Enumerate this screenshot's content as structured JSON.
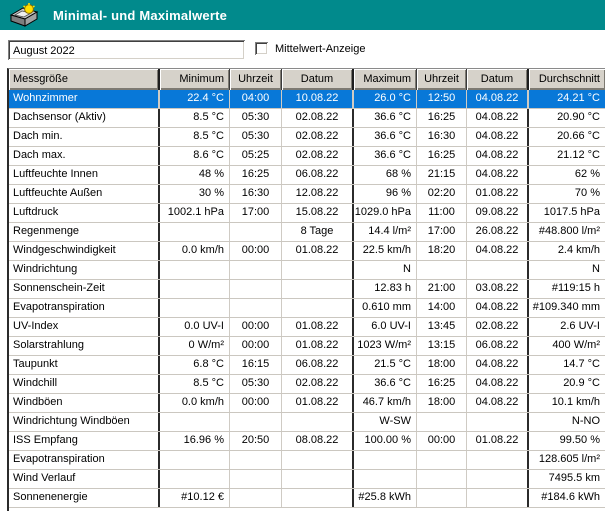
{
  "window": {
    "title": "Minimal- und Maximalwerte",
    "icon": "weather-station-icon"
  },
  "toolbar": {
    "period_value": "August 2022",
    "checkbox_label": "Mittelwert-Anzeige",
    "checkbox_checked": false
  },
  "colors": {
    "titlebar": "#018a8c",
    "selection": "#0878d8",
    "header_bg": "#d6d2ca"
  },
  "table": {
    "columns": [
      "Messgröße",
      "Minimum",
      "Uhrzeit",
      "Datum",
      "Maximum",
      "Uhrzeit",
      "Datum",
      "Durchschnitt"
    ],
    "selected_row": 0,
    "rows": [
      [
        "Wohnzimmer",
        "22.4 °C",
        "04:00",
        "10.08.22",
        "26.0 °C",
        "12:50",
        "04.08.22",
        "24.21 °C"
      ],
      [
        "Dachsensor (Aktiv)",
        "8.5 °C",
        "05:30",
        "02.08.22",
        "36.6 °C",
        "16:25",
        "04.08.22",
        "20.90 °C"
      ],
      [
        "Dach min.",
        "8.5 °C",
        "05:30",
        "02.08.22",
        "36.6 °C",
        "16:30",
        "04.08.22",
        "20.66 °C"
      ],
      [
        "Dach max.",
        "8.6 °C",
        "05:25",
        "02.08.22",
        "36.6 °C",
        "16:25",
        "04.08.22",
        "21.12 °C"
      ],
      [
        "Luftfeuchte Innen",
        "48 %",
        "16:25",
        "06.08.22",
        "68 %",
        "21:15",
        "04.08.22",
        "62 %"
      ],
      [
        "Luftfeuchte Außen",
        "30 %",
        "16:30",
        "12.08.22",
        "96 %",
        "02:20",
        "01.08.22",
        "70 %"
      ],
      [
        "Luftdruck",
        "1002.1 hPa",
        "17:00",
        "15.08.22",
        "1029.0 hPa",
        "11:00",
        "09.08.22",
        "1017.5 hPa"
      ],
      [
        "Regenmenge",
        "",
        "",
        "8 Tage",
        "14.4 l/m²",
        "17:00",
        "26.08.22",
        "#48.800 l/m²"
      ],
      [
        "Windgeschwindigkeit",
        "0.0 km/h",
        "00:00",
        "01.08.22",
        "22.5 km/h",
        "18:20",
        "04.08.22",
        "2.4 km/h"
      ],
      [
        "Windrichtung",
        "",
        "",
        "",
        "N",
        "",
        "",
        "N"
      ],
      [
        "Sonnenschein-Zeit",
        "",
        "",
        "",
        "12.83 h",
        "21:00",
        "03.08.22",
        "#119:15 h"
      ],
      [
        "Evapotranspiration",
        "",
        "",
        "",
        "0.610 mm",
        "14:00",
        "04.08.22",
        "#109.340 mm"
      ],
      [
        "UV-Index",
        "0.0 UV-I",
        "00:00",
        "01.08.22",
        "6.0 UV-I",
        "13:45",
        "02.08.22",
        "2.6 UV-I"
      ],
      [
        "Solarstrahlung",
        "0 W/m²",
        "00:00",
        "01.08.22",
        "1023 W/m²",
        "13:15",
        "06.08.22",
        "400 W/m²"
      ],
      [
        "Taupunkt",
        "6.8 °C",
        "16:15",
        "06.08.22",
        "21.5 °C",
        "18:00",
        "04.08.22",
        "14.7 °C"
      ],
      [
        "Windchill",
        "8.5 °C",
        "05:30",
        "02.08.22",
        "36.6 °C",
        "16:25",
        "04.08.22",
        "20.9 °C"
      ],
      [
        "Windböen",
        "0.0 km/h",
        "00:00",
        "01.08.22",
        "46.7 km/h",
        "18:00",
        "04.08.22",
        "10.1 km/h"
      ],
      [
        "Windrichtung Windböen",
        "",
        "",
        "",
        "W-SW",
        "",
        "",
        "N-NO"
      ],
      [
        "ISS Empfang",
        "16.96 %",
        "20:50",
        "08.08.22",
        "100.00 %",
        "00:00",
        "01.08.22",
        "99.50 %"
      ],
      [
        "Evapotranspiration",
        "",
        "",
        "",
        "",
        "",
        "",
        "128.605 l/m²"
      ],
      [
        "Wind Verlauf",
        "",
        "",
        "",
        "",
        "",
        "",
        "7495.5 km"
      ],
      [
        "Sonnenenergie",
        "#10.12 €",
        "",
        "",
        "#25.8 kWh",
        "",
        "",
        "#184.6 kWh"
      ]
    ]
  }
}
